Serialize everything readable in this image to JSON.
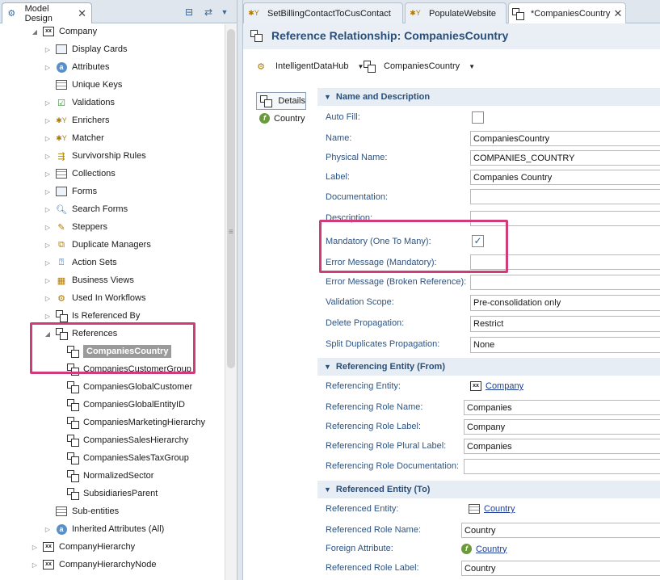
{
  "left_panel": {
    "tab_title": "Model Design",
    "tree": [
      {
        "label": "Company",
        "level": 1,
        "expanded": true,
        "icon": "entity-icon"
      },
      {
        "label": "Display Cards",
        "level": 2,
        "icon": "card-icon"
      },
      {
        "label": "Attributes",
        "level": 2,
        "icon": "attribute-icon"
      },
      {
        "label": "Unique Keys",
        "level": 2,
        "icon": "key-icon"
      },
      {
        "label": "Validations",
        "level": 2,
        "icon": "validation-icon"
      },
      {
        "label": "Enrichers",
        "level": 2,
        "icon": "enricher-icon"
      },
      {
        "label": "Matcher",
        "level": 2,
        "icon": "matcher-icon"
      },
      {
        "label": "Survivorship Rules",
        "level": 2,
        "icon": "rules-icon"
      },
      {
        "label": "Collections",
        "level": 2,
        "icon": "collection-icon"
      },
      {
        "label": "Forms",
        "level": 2,
        "icon": "form-icon"
      },
      {
        "label": "Search Forms",
        "level": 2,
        "icon": "search-form-icon"
      },
      {
        "label": "Steppers",
        "level": 2,
        "icon": "stepper-icon"
      },
      {
        "label": "Duplicate Managers",
        "level": 2,
        "icon": "duplicate-icon"
      },
      {
        "label": "Action Sets",
        "level": 2,
        "icon": "action-icon"
      },
      {
        "label": "Business Views",
        "level": 2,
        "icon": "business-view-icon"
      },
      {
        "label": "Used In Workflows",
        "level": 2,
        "icon": "workflow-icon"
      },
      {
        "label": "Is Referenced By",
        "level": 2,
        "icon": "reference-icon"
      },
      {
        "label": "References",
        "level": 2,
        "expanded": true,
        "icon": "reference-icon"
      },
      {
        "label": "CompaniesCountry",
        "level": 3,
        "selected": true,
        "icon": "reference-icon"
      },
      {
        "label": "CompaniesCustomerGroup",
        "level": 3,
        "icon": "reference-icon"
      },
      {
        "label": "CompaniesGlobalCustomer",
        "level": 3,
        "icon": "reference-icon"
      },
      {
        "label": "CompaniesGlobalEntityID",
        "level": 3,
        "icon": "reference-icon"
      },
      {
        "label": "CompaniesMarketingHierarchy",
        "level": 3,
        "icon": "reference-icon"
      },
      {
        "label": "CompaniesSalesHierarchy",
        "level": 3,
        "icon": "reference-icon"
      },
      {
        "label": "CompaniesSalesTaxGroup",
        "level": 3,
        "icon": "reference-icon"
      },
      {
        "label": "NormalizedSector",
        "level": 3,
        "icon": "reference-icon"
      },
      {
        "label": "SubsidiariesParent",
        "level": 3,
        "icon": "reference-icon"
      },
      {
        "label": "Sub-entities",
        "level": 2,
        "icon": "box-icon"
      },
      {
        "label": "Inherited Attributes (All)",
        "level": 2,
        "icon": "attribute-icon"
      },
      {
        "label": "CompanyHierarchy",
        "level": 1,
        "icon": "entity-icon"
      },
      {
        "label": "CompanyHierarchyNode",
        "level": 1,
        "icon": "entity-icon"
      }
    ]
  },
  "editor": {
    "tabs": [
      {
        "label": "SetBillingContactToCusContact"
      },
      {
        "label": "PopulateWebsite"
      },
      {
        "label": "*CompaniesCountry",
        "active": true
      }
    ],
    "title": "Reference Relationship: CompaniesCountry",
    "breadcrumbs": [
      "IntelligentDataHub",
      "CompaniesCountry"
    ],
    "side_nav": {
      "details": "Details",
      "country": "Country"
    },
    "sections": {
      "name_desc": "Name and Description",
      "referencing": "Referencing Entity (From)",
      "referenced": "Referenced Entity (To)"
    },
    "fields": {
      "auto_fill": {
        "label": "Auto Fill:",
        "checked": false
      },
      "name": {
        "label": "Name:",
        "value": "CompaniesCountry"
      },
      "physical_name": {
        "label": "Physical Name:",
        "value": "COMPANIES_COUNTRY"
      },
      "label": {
        "label": "Label:",
        "value": "Companies Country"
      },
      "documentation": {
        "label": "Documentation:",
        "value": ""
      },
      "description": {
        "label": "Description:",
        "value": ""
      },
      "mandatory": {
        "label": "Mandatory (One To Many):",
        "checked": true
      },
      "error_mandatory": {
        "label": "Error Message (Mandatory):",
        "value": ""
      },
      "error_broken": {
        "label": "Error Message (Broken Reference):",
        "value": ""
      },
      "validation_scope": {
        "label": "Validation Scope:",
        "value": "Pre-consolidation only"
      },
      "delete_propagation": {
        "label": "Delete Propagation:",
        "value": "Restrict"
      },
      "split_duplicates": {
        "label": "Split Duplicates Propagation:",
        "value": "None"
      },
      "referencing_entity": {
        "label": "Referencing Entity:",
        "value": "Company"
      },
      "referencing_role_name": {
        "label": "Referencing Role Name:",
        "value": "Companies"
      },
      "referencing_role_label": {
        "label": "Referencing Role Label:",
        "value": "Company"
      },
      "referencing_role_plural": {
        "label": "Referencing Role Plural Label:",
        "value": "Companies"
      },
      "referencing_role_doc": {
        "label": "Referencing Role Documentation:",
        "value": ""
      },
      "referenced_entity": {
        "label": "Referenced Entity:",
        "value": "Country"
      },
      "referenced_role_name": {
        "label": "Referenced Role Name:",
        "value": "Country"
      },
      "foreign_attribute": {
        "label": "Foreign Attribute:",
        "value": "Country"
      },
      "referenced_role_label": {
        "label": "Referenced Role Label:",
        "value": "Country"
      }
    }
  },
  "colors": {
    "highlight": "#d03c7a",
    "label_blue": "#2c5485",
    "title_blue": "#2a4e78"
  }
}
